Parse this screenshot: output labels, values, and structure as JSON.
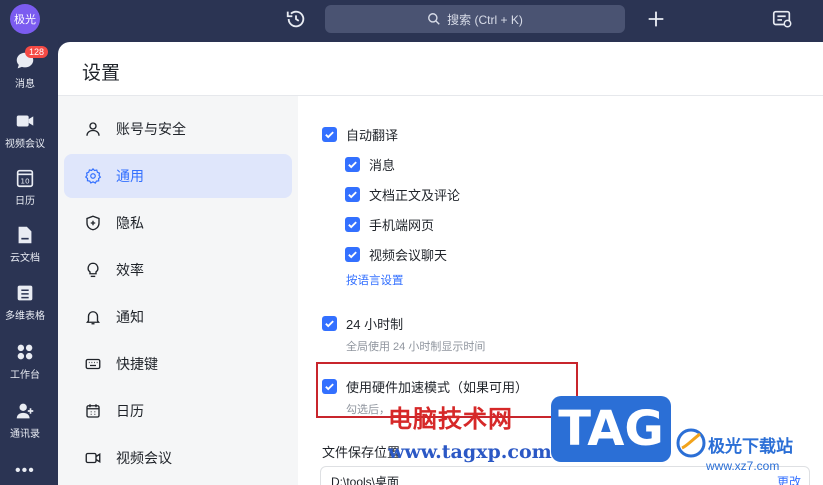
{
  "topbar": {
    "avatar_text": "极光",
    "search_label": "搜索 (Ctrl + K)"
  },
  "rail": {
    "items": [
      {
        "label": "消息",
        "icon": "chat-icon",
        "badge": "128"
      },
      {
        "label": "视频会议",
        "icon": "video-icon"
      },
      {
        "label": "日历",
        "icon": "calendar-icon",
        "icon_text": "10"
      },
      {
        "label": "云文档",
        "icon": "cloud-doc-icon"
      },
      {
        "label": "多维表格",
        "icon": "table-icon"
      },
      {
        "label": "工作台",
        "icon": "workspace-icon"
      },
      {
        "label": "通讯录",
        "icon": "contacts-icon"
      }
    ],
    "more": "•••"
  },
  "panel": {
    "title": "设置",
    "side_items": [
      {
        "label": "账号与安全",
        "icon": "user-icon"
      },
      {
        "label": "通用",
        "icon": "gear-icon",
        "active": true
      },
      {
        "label": "隐私",
        "icon": "shield-icon"
      },
      {
        "label": "效率",
        "icon": "bulb-icon"
      },
      {
        "label": "通知",
        "icon": "bell-icon"
      },
      {
        "label": "快捷键",
        "icon": "keyboard-icon"
      },
      {
        "label": "日历",
        "icon": "calendar-small-icon"
      },
      {
        "label": "视频会议",
        "icon": "camera-icon"
      }
    ]
  },
  "content": {
    "auto_translate": {
      "label": "自动翻译",
      "checked": true
    },
    "translate_options": [
      {
        "label": "消息",
        "checked": true
      },
      {
        "label": "文档正文及评论",
        "checked": true
      },
      {
        "label": "手机端网页",
        "checked": true
      },
      {
        "label": "视频会议聊天",
        "checked": true
      }
    ],
    "language_link": "按语言设置",
    "clock24": {
      "label": "24 小时制",
      "checked": true,
      "hint": "全局使用 24 小时制显示时间"
    },
    "hw_accel": {
      "label": "使用硬件加速模式（如果可用）",
      "checked": true,
      "hint": "勾选后，"
    },
    "file_save": {
      "label": "文件保存位置",
      "path": "D:\\tools\\桌面",
      "change": "更改"
    }
  },
  "watermark": {
    "cn_text": "电脑技术网",
    "url": "www.tagxp.com",
    "tag": "TAG",
    "site_name": "极光下载站",
    "site_url": "www.xz7.com"
  },
  "colors": {
    "accent": "#3370ff",
    "rail_bg": "#2b3453",
    "highlight_box": "#c8252c"
  }
}
